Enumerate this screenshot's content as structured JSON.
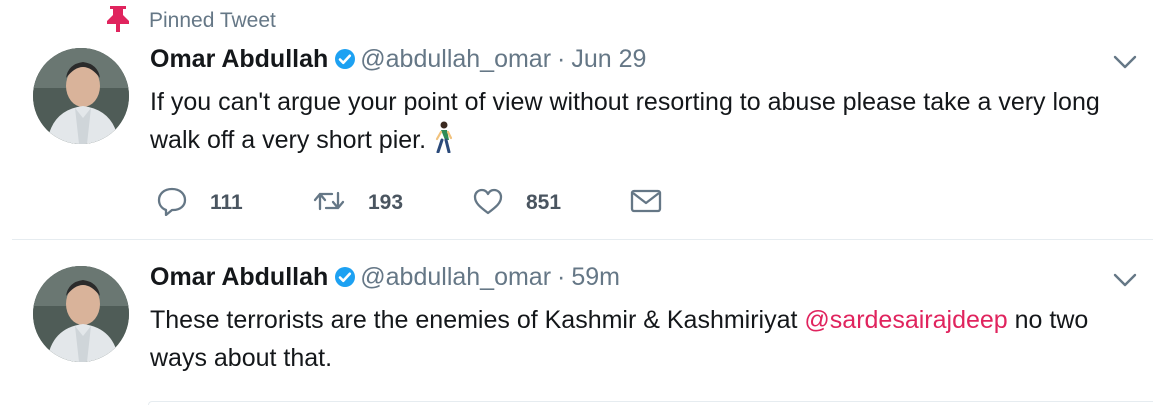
{
  "pinned": {
    "label": "Pinned Tweet",
    "icon": "pin-icon",
    "icon_color": "#e0245e"
  },
  "tweets": [
    {
      "author_name": "Omar Abdullah",
      "handle": "@abdullah_omar",
      "separator": "·",
      "time": "Jun 29",
      "text": "If you can't argue your point of view without resorting to abuse please take a very long walk off a very short pier.",
      "emoji": "person-walking-emoji",
      "reply_count": "111",
      "retweet_count": "193",
      "like_count": "851"
    },
    {
      "author_name": "Omar Abdullah",
      "handle": "@abdullah_omar",
      "separator": "·",
      "time": "59m",
      "text_before": "These terrorists are the enemies of Kashmir & Kashmiriyat ",
      "mention": "@sardesairajdeep",
      "text_after": " no two ways about that."
    }
  ],
  "colors": {
    "text_primary": "#14171a",
    "text_secondary": "#657786",
    "verified_blue": "#1da1f2",
    "mention_red": "#e0245e",
    "divider": "#e6ecf0"
  }
}
